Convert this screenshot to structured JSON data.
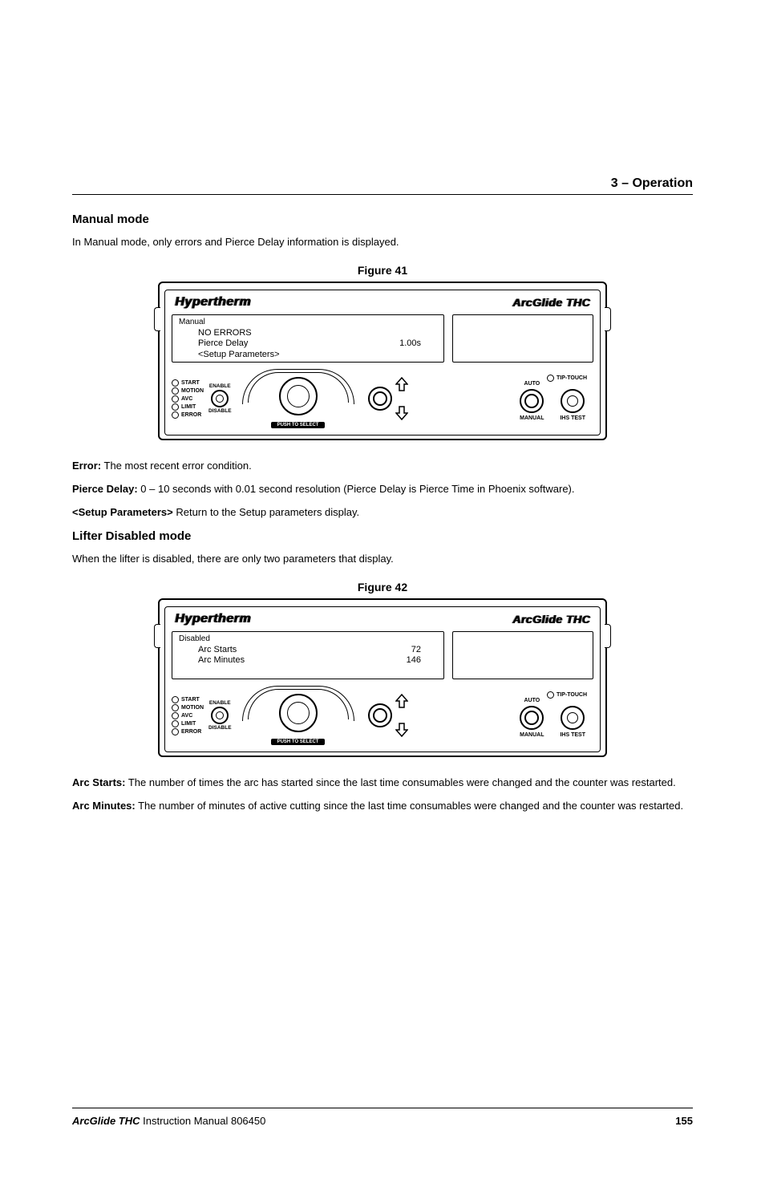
{
  "header": {
    "section": "3 – Operation"
  },
  "manual": {
    "title": "Manual mode",
    "intro": "In Manual mode, only errors and Pierce Delay information is displayed."
  },
  "figure41": {
    "label": "Figure 41",
    "brand_left": "Hypertherm",
    "brand_right": "ArcGlide THC",
    "lcd": {
      "mode": "Manual",
      "line1": "NO ERRORS",
      "line2_label": "Pierce Delay",
      "line2_value": "1.00s",
      "line3": "<Setup Parameters>"
    },
    "leds": [
      "START",
      "MOTION",
      "AVC",
      "LIMIT",
      "ERROR"
    ],
    "switch_top": "ENABLE",
    "switch_bottom": "DISABLE",
    "push": "PUSH TO SELECT",
    "knob_top": "AUTO",
    "knob_bottom": "MANUAL",
    "tip": "TIP-TOUCH",
    "ihs": "IHS TEST"
  },
  "defs1": {
    "error_label": "Error:",
    "error_text": " The most recent error condition.",
    "pierce_label": "Pierce Delay:",
    "pierce_text": " 0 – 10 seconds with 0.01 second resolution (Pierce Delay is Pierce Time in Phoenix software).",
    "setup_label": "<Setup Parameters>",
    "setup_text": " Return to the Setup parameters display."
  },
  "lifter": {
    "title": "Lifter Disabled mode",
    "intro": "When the lifter is disabled, there are only two parameters that display."
  },
  "figure42": {
    "label": "Figure 42",
    "brand_left": "Hypertherm",
    "brand_right": "ArcGlide THC",
    "lcd": {
      "mode": "Disabled",
      "line1_label": "Arc Starts",
      "line1_value": "72",
      "line2_label": "Arc Minutes",
      "line2_value": "146"
    },
    "leds": [
      "START",
      "MOTION",
      "AVC",
      "LIMIT",
      "ERROR"
    ],
    "switch_top": "ENABLE",
    "switch_bottom": "DISABLE",
    "push": "PUSH TO SELECT",
    "knob_top": "AUTO",
    "knob_bottom": "MANUAL",
    "tip": "TIP-TOUCH",
    "ihs": "IHS TEST"
  },
  "defs2": {
    "arcstarts_label": "Arc Starts:",
    "arcstarts_text": " The number of times the arc has started since the last time consumables were changed and the counter was restarted.",
    "arcmin_label": "Arc Minutes:",
    "arcmin_text": " The number of minutes of active cutting since the last time consumables were changed and the counter was restarted."
  },
  "footer": {
    "product": "ArcGlide THC",
    "manual": "  Instruction Manual  806450",
    "page": "155"
  }
}
